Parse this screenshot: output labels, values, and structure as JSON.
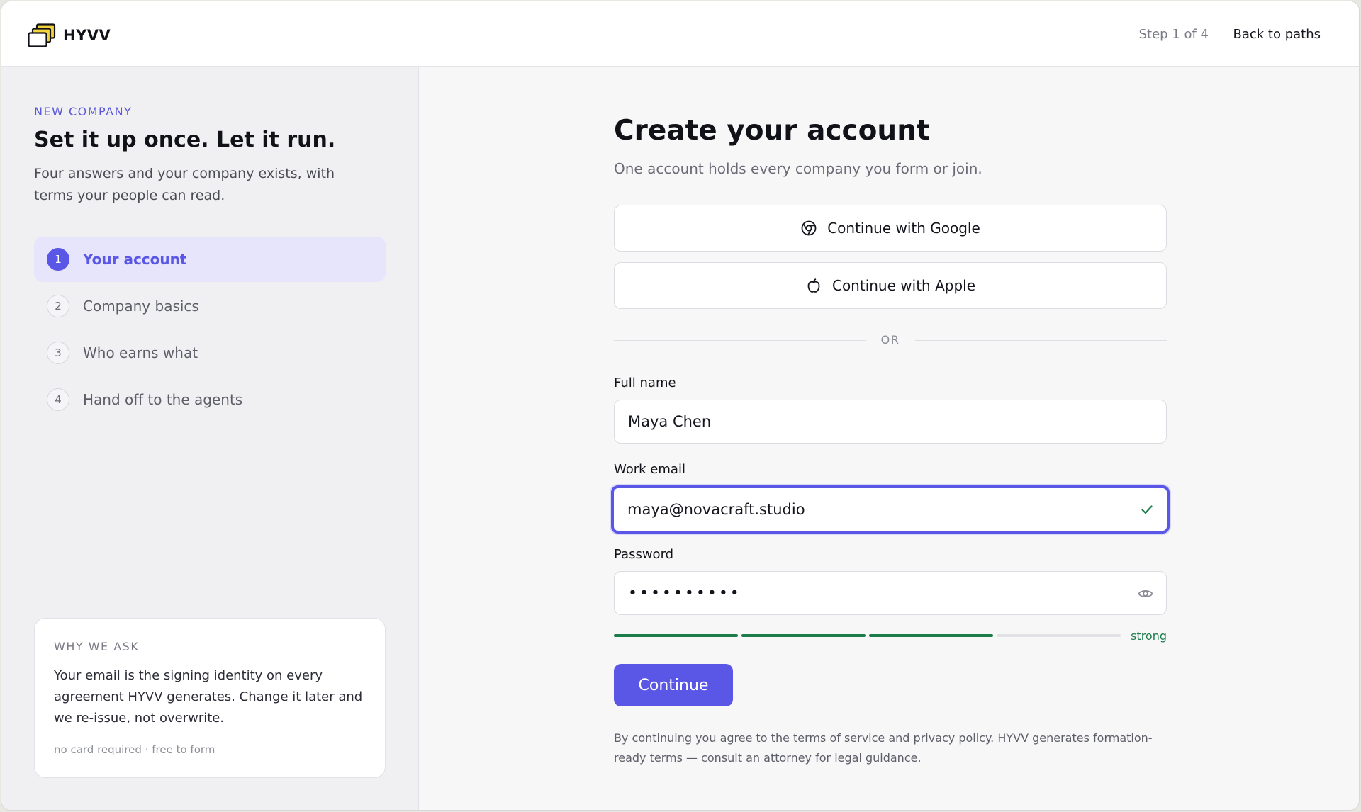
{
  "header": {
    "brand_name": "HYVV",
    "step_indicator": "Step 1 of 4",
    "back_link": "Back to paths"
  },
  "sidebar": {
    "eyebrow": "NEW COMPANY",
    "title": "Set it up once. Let it run.",
    "description": "Four answers and your company exists, with terms your people can read.",
    "steps": [
      {
        "number": "1",
        "label": "Your account",
        "active": true
      },
      {
        "number": "2",
        "label": "Company basics",
        "active": false
      },
      {
        "number": "3",
        "label": "Who earns what",
        "active": false
      },
      {
        "number": "4",
        "label": "Hand off to the agents",
        "active": false
      }
    ],
    "why_card": {
      "title": "WHY WE ASK",
      "body": "Your email is the signing identity on every agreement HYVV generates. Change it later and we re-issue, not overwrite.",
      "footnote": "no card required · free to form"
    }
  },
  "form": {
    "title": "Create your account",
    "subtitle": "One account holds every company you form or join.",
    "google_label": "Continue with Google",
    "apple_label": "Continue with Apple",
    "divider_label": "OR",
    "full_name": {
      "label": "Full name",
      "value": "Maya Chen"
    },
    "work_email": {
      "label": "Work email",
      "value": "maya@novacraft.studio"
    },
    "password": {
      "label": "Password",
      "value": "••••••••••",
      "strength_label": "strong",
      "strength_level": 0.75
    },
    "continue_label": "Continue",
    "legal": "By continuing you agree to the terms of service and privacy policy. HYVV generates formation-ready terms — consult an attorney for legal guidance."
  },
  "colors": {
    "accent": "#5b57e6",
    "success": "#1c7c4a",
    "logo_yellow": "#f2d33d"
  },
  "icons": {
    "google": "chrome-icon",
    "apple": "apple-icon",
    "email_valid": "check-icon",
    "password_toggle": "eye-icon",
    "logo": "stacked-windows-logo"
  }
}
